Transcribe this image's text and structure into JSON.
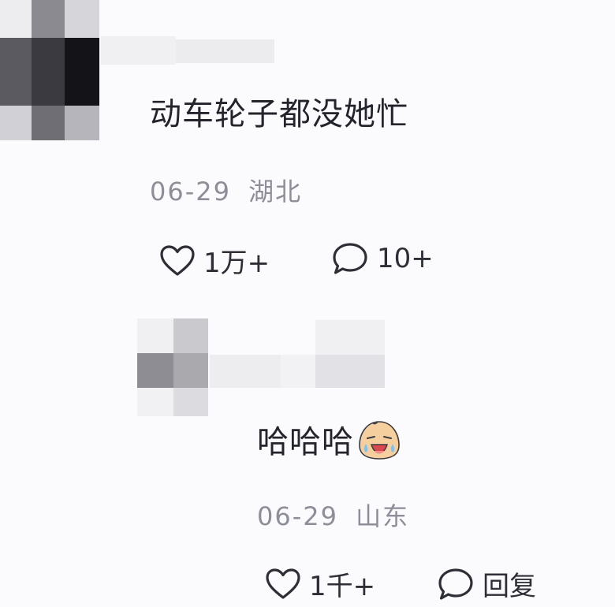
{
  "comment": {
    "text": "动车轮子都没她忙",
    "date": "06-29",
    "location": "湖北",
    "likes": "1万+",
    "replies": "10+",
    "like_icon": "heart-outline-icon",
    "reply_icon": "speech-bubble-icon"
  },
  "reply": {
    "text": "哈哈哈",
    "emoji": "laughing-crying-face-emoji",
    "date": "06-29",
    "location": "山东",
    "likes": "1千+",
    "reply_label": "回复",
    "like_icon": "heart-outline-icon",
    "reply_icon": "speech-bubble-icon"
  },
  "colors": {
    "text": "#24242c",
    "meta": "#8e8e98",
    "background": "#fbfbfd"
  }
}
